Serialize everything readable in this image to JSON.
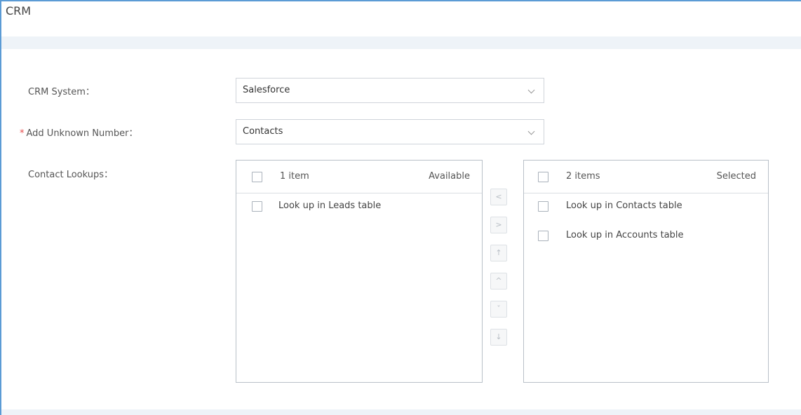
{
  "page": {
    "title": "CRM"
  },
  "form": {
    "crm_system": {
      "label": "CRM System：",
      "value": "Salesforce"
    },
    "add_unknown_number": {
      "required_mark": "*",
      "label": "Add Unknown Number：",
      "value": "Contacts"
    },
    "contact_lookups": {
      "label": "Contact Lookups："
    }
  },
  "transfer": {
    "available": {
      "count": "1 item",
      "title": "Available",
      "items": [
        {
          "label": "Look up in Leads table",
          "checked": false
        }
      ]
    },
    "selected": {
      "count": "2 items",
      "title": "Selected",
      "items": [
        {
          "label": "Look up in Contacts table",
          "checked": false
        },
        {
          "label": "Look up in Accounts table",
          "checked": false
        }
      ]
    },
    "operations": [
      {
        "name": "move-left-button",
        "glyph": "<"
      },
      {
        "name": "move-right-button",
        "glyph": ">"
      },
      {
        "name": "move-top-button",
        "glyph": "↑"
      },
      {
        "name": "move-up-button",
        "glyph": "^"
      },
      {
        "name": "move-down-button",
        "glyph": "ˇ"
      },
      {
        "name": "move-bottom-button",
        "glyph": "↓"
      }
    ]
  },
  "colors": {
    "accent_border": "#5b9bd5",
    "band_background": "#eef3f8",
    "required_star": "#e64b4b"
  }
}
